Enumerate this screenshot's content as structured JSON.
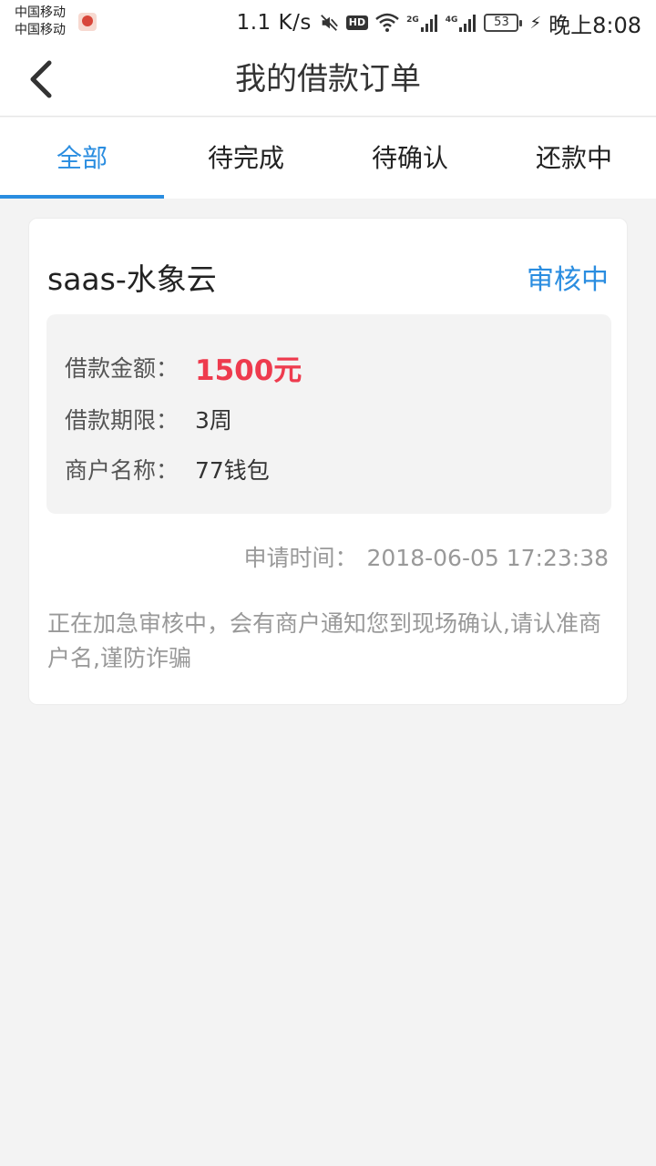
{
  "status_bar": {
    "carrier_1": "中国移动",
    "carrier_2": "中国移动",
    "net_speed": "1.1 K/s",
    "hd_label": "HD",
    "signal_1_tag": "2G",
    "signal_2_tag": "4G",
    "battery_level": "53",
    "time": "晚上8:08"
  },
  "header": {
    "title": "我的借款订单",
    "back_icon": "chevron-left-icon"
  },
  "tabs": [
    {
      "label": "全部",
      "active": true
    },
    {
      "label": "待完成",
      "active": false
    },
    {
      "label": "待确认",
      "active": false
    },
    {
      "label": "还款中",
      "active": false
    }
  ],
  "order": {
    "merchant": "saas-水象云",
    "status": "审核中",
    "details": {
      "amount_label": "借款金额：",
      "amount_value": "1500元",
      "term_label": "借款期限：",
      "term_value": "3周",
      "merchant_label": "商户名称：",
      "merchant_value": "77钱包"
    },
    "apply_time_label": "申请时间：",
    "apply_time_value": "2018-06-05 17:23:38",
    "notice": "正在加急审核中，会有商户通知您到现场确认,请认准商户名,谨防诈骗"
  },
  "colors": {
    "accent": "#2a8de0",
    "amount": "#ee3b4e",
    "background": "#f3f3f3"
  }
}
